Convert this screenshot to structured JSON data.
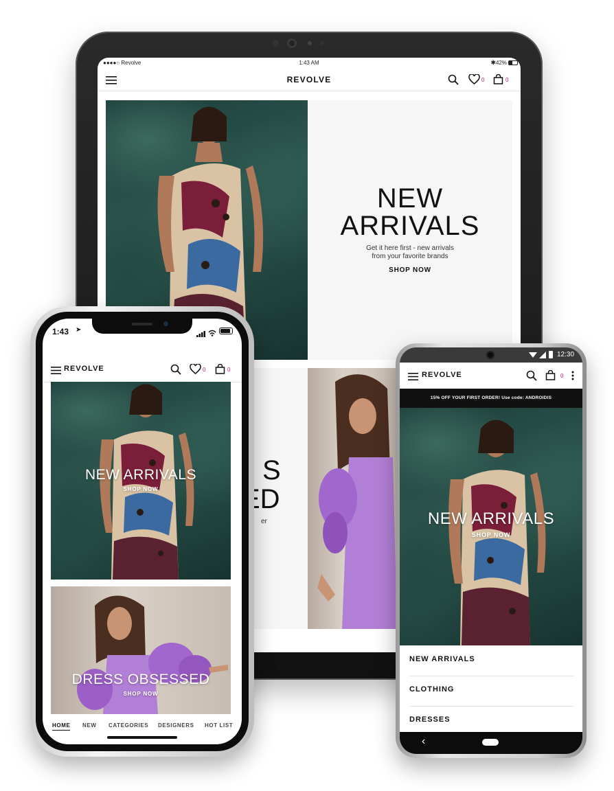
{
  "brand": "REVOLVE",
  "colors": {
    "badge": "#c2187a",
    "lilac": "#a46ad0",
    "jungle": "#24463f",
    "promo_bar": "#111111"
  },
  "tablet": {
    "status": {
      "carrier": "●●●●○ Revolve",
      "time": "1:43 AM",
      "battery": "42%"
    },
    "cart_count": "0",
    "wishlist_count": "0",
    "hero": {
      "headline_1": "NEW",
      "headline_2": "ARRIVALS",
      "sub_1": "Get it here first - new arrivals",
      "sub_2": "from your favorite brands",
      "cta": "SHOP NOW"
    },
    "second": {
      "headline_1": "S",
      "headline_2": "ED",
      "sub": "er"
    }
  },
  "iphone": {
    "status": {
      "time": "1:43"
    },
    "wishlist_count": "0",
    "cart_count": "0",
    "banner1": {
      "title": "NEW ARRIVALS",
      "cta": "SHOP NOW"
    },
    "banner2": {
      "title": "DRESS OBSESSED",
      "cta": "SHOP NOW"
    },
    "tabs": [
      {
        "label": "HOME",
        "active": true
      },
      {
        "label": "NEW"
      },
      {
        "label": "CATEGORIES"
      },
      {
        "label": "DESIGNERS"
      },
      {
        "label": "HOT LIST"
      }
    ]
  },
  "android": {
    "status": {
      "time": "12:30"
    },
    "cart_count": "0",
    "promo": "15% OFF YOUR FIRST ORDER! Use code: ANDROIDIS",
    "banner": {
      "title": "NEW ARRIVALS",
      "cta": "SHOP NOW"
    },
    "menu": [
      "NEW ARRIVALS",
      "CLOTHING",
      "DRESSES"
    ]
  },
  "icons": [
    "menu-icon",
    "search-icon",
    "heart-icon",
    "bag-icon",
    "overflow-icon",
    "back-icon",
    "home-pill-icon",
    "wifi-icon",
    "signal-icon",
    "battery-icon",
    "bluetooth-icon",
    "location-arrow-icon"
  ]
}
